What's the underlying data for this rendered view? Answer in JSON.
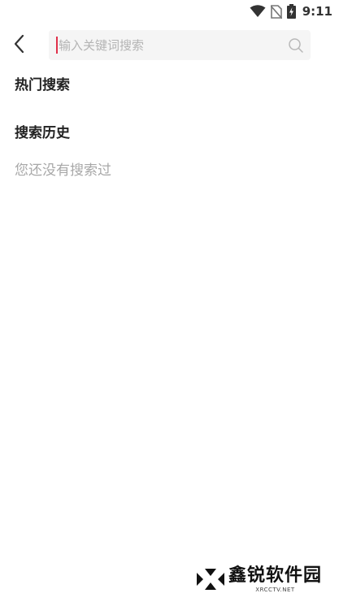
{
  "status_bar": {
    "time": "9:11",
    "icons": [
      "wifi-icon",
      "no-sim-icon",
      "battery-charging-icon"
    ]
  },
  "header": {
    "back_icon": "chevron-left-icon",
    "search": {
      "placeholder": "输入关键词搜索",
      "value": "",
      "icon": "search-icon",
      "caret_color": "#e0304a"
    }
  },
  "hot_search": {
    "title": "热门搜索"
  },
  "search_history": {
    "title": "搜索历史",
    "empty_text": "您还没有搜索过"
  },
  "watermark": {
    "title": "鑫锐软件园",
    "subtitle": "XRCCTV.NET"
  }
}
